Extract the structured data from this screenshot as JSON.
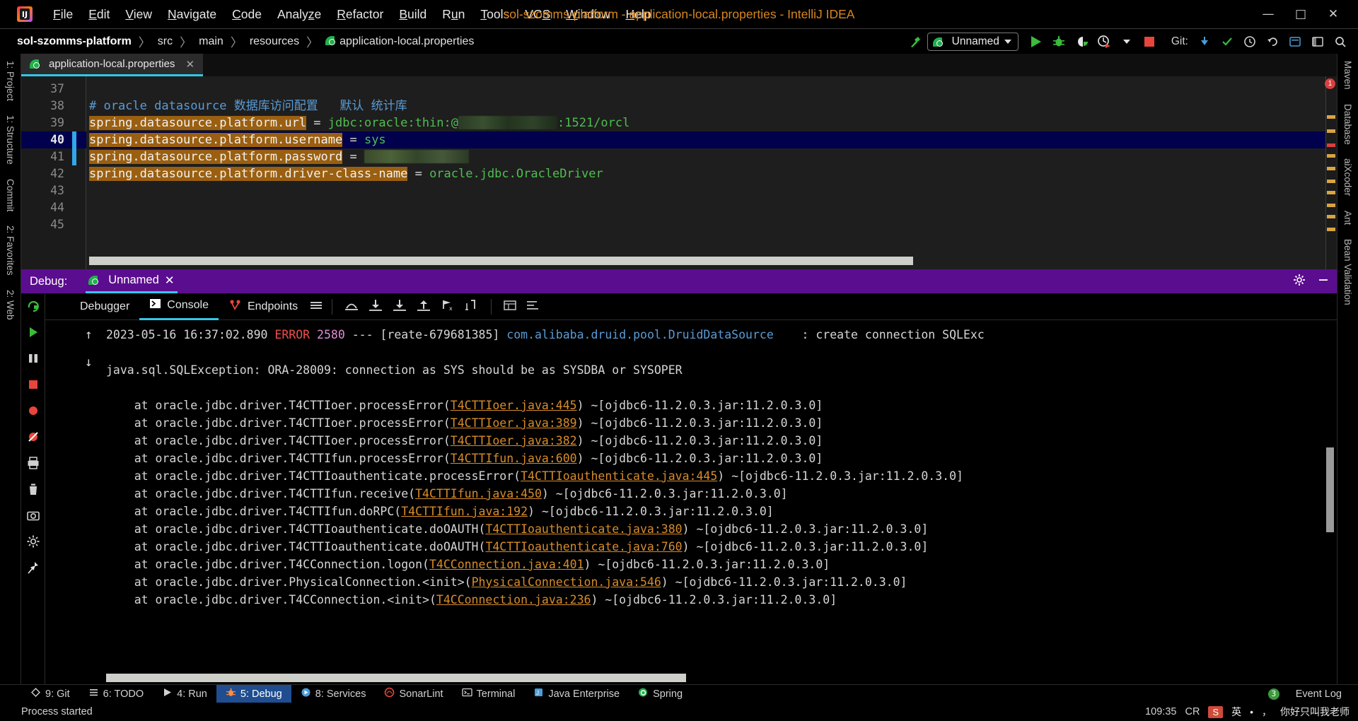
{
  "window": {
    "title": "sol-szomms-platform - application-local.properties - IntelliJ IDEA",
    "minimize": "—",
    "maximize": "□",
    "close": "✕",
    "logo_text": "IJ"
  },
  "menu": [
    {
      "label": "File",
      "mnemonic": "F"
    },
    {
      "label": "Edit",
      "mnemonic": "E"
    },
    {
      "label": "View",
      "mnemonic": "V"
    },
    {
      "label": "Navigate",
      "mnemonic": "N"
    },
    {
      "label": "Code",
      "mnemonic": "C"
    },
    {
      "label": "Analyze",
      "mnemonic": "z"
    },
    {
      "label": "Refactor",
      "mnemonic": "R"
    },
    {
      "label": "Build",
      "mnemonic": "B"
    },
    {
      "label": "Run",
      "mnemonic": "u"
    },
    {
      "label": "Tools",
      "mnemonic": "T"
    },
    {
      "label": "VCS",
      "mnemonic": "S"
    },
    {
      "label": "Window",
      "mnemonic": "W"
    },
    {
      "label": "Help",
      "mnemonic": "H"
    }
  ],
  "breadcrumb": {
    "items": [
      "sol-szomms-platform",
      "src",
      "main",
      "resources",
      "application-local.properties"
    ],
    "separator": "〉"
  },
  "toolbar": {
    "run_config": "Unnamed",
    "git_label": "Git:",
    "build_icon": "build-hammer-icon",
    "run_icon": "run-icon",
    "debug_icon": "debug-icon",
    "coverage_icon": "coverage-icon",
    "profiler_icon": "profiler-icon",
    "stop_icon": "stop-icon",
    "update_icon": "update-project-icon",
    "commit_icon": "commit-icon",
    "history_icon": "history-icon",
    "rollback_icon": "rollback-icon",
    "settings_icon": "settings-icon",
    "layout_icon": "layout-icon",
    "search_icon": "search-icon"
  },
  "left_stripe": [
    {
      "label": "1: Project",
      "name": "tool-project"
    },
    {
      "label": "1: Structure",
      "name": "tool-structure"
    },
    {
      "label": "Commit",
      "name": "tool-commit"
    },
    {
      "label": "2: Favorites",
      "name": "tool-favorites"
    },
    {
      "label": "2: Web",
      "name": "tool-web"
    }
  ],
  "right_stripe": [
    {
      "label": "Maven",
      "name": "tool-maven"
    },
    {
      "label": "Database",
      "name": "tool-database"
    },
    {
      "label": "aiXcoder",
      "name": "tool-aixcoder"
    },
    {
      "label": "Ant",
      "name": "tool-ant"
    },
    {
      "label": "Bean Validation",
      "name": "tool-bean-validation"
    }
  ],
  "editor": {
    "tab_label": "application-local.properties",
    "tab_close": "✕",
    "error_count": "1",
    "lines": [
      {
        "no": "37",
        "segments": []
      },
      {
        "no": "38",
        "segments": [
          {
            "t": "# oracle datasource 数据库访问配置   默认 统计库",
            "c": "k-cmt"
          }
        ]
      },
      {
        "no": "39",
        "segments": [
          {
            "t": "spring.datasource.platform.url",
            "c": "k-key"
          },
          {
            "t": " = ",
            "c": "k-eq"
          },
          {
            "t": "jdbc:oracle:thin:@",
            "c": "k-val"
          },
          {
            "t": "",
            "c": "blur",
            "w": 140
          },
          {
            "t": ":1521/orcl",
            "c": "k-val"
          }
        ]
      },
      {
        "no": "40",
        "selected": true,
        "segments": [
          {
            "t": "spring.datasource.platform.username",
            "c": "k-key"
          },
          {
            "t": " = ",
            "c": "k-eq"
          },
          {
            "t": "sys",
            "c": "k-val"
          }
        ]
      },
      {
        "no": "41",
        "segments": [
          {
            "t": "spring.datasource.platform.password",
            "c": "k-key"
          },
          {
            "t": " = ",
            "c": "k-eq"
          },
          {
            "t": "",
            "c": "blurpw",
            "w": 148
          }
        ]
      },
      {
        "no": "42",
        "segments": [
          {
            "t": "spring.datasource.platform.driver-class-name",
            "c": "k-key"
          },
          {
            "t": " = ",
            "c": "k-eq"
          },
          {
            "t": "oracle.jdbc.OracleDriver",
            "c": "k-val"
          }
        ]
      },
      {
        "no": "43",
        "segments": []
      },
      {
        "no": "44",
        "segments": []
      },
      {
        "no": "45",
        "segments": []
      }
    ]
  },
  "debug": {
    "panel_label": "Debug:",
    "session_tab": "Unnamed",
    "session_close": "✕",
    "settings_icon": "settings-gear-icon",
    "hide_icon": "hide-panel-icon",
    "tabs": [
      {
        "label": "Debugger",
        "icon": "debugger-icon",
        "active": false
      },
      {
        "label": "Console",
        "icon": "console-icon",
        "active": true
      },
      {
        "label": "Endpoints",
        "icon": "endpoints-icon",
        "active": false
      }
    ],
    "toolbar_icons": [
      "layout-menu-icon",
      "step-over-icon",
      "step-into-icon",
      "force-step-into-icon",
      "step-out-icon",
      "run-to-cursor-icon",
      "evaluate-icon",
      "frames-icon",
      "soft-wrap-icon"
    ],
    "side_icons": [
      "rerun-icon",
      "resume-icon",
      "pause-icon",
      "stop-icon",
      "view-breakpoints-icon",
      "mute-breakpoints-icon",
      "print-icon",
      "delete-icon",
      "camera-icon",
      "settings-icon",
      "pin-icon"
    ],
    "stack_arrows": [
      "↑",
      "↓"
    ],
    "console_lines": [
      {
        "segments": [
          {
            "t": "2023-05-16 16:37:02.890 ",
            "c": "plain"
          },
          {
            "t": "ERROR",
            "c": "c-err"
          },
          {
            "t": " ",
            "c": "plain"
          },
          {
            "t": "2580",
            "c": "c-pid"
          },
          {
            "t": " --- [reate-679681385] ",
            "c": "plain"
          },
          {
            "t": "com.alibaba.druid.pool.DruidDataSource",
            "c": "c-cls"
          },
          {
            "t": "    : create connection SQLExc",
            "c": "plain"
          }
        ]
      },
      {
        "segments": []
      },
      {
        "segments": [
          {
            "t": "java.sql.SQLException: ORA-28009: connection as SYS should be as SYSDBA or SYSOPER",
            "c": "plain"
          }
        ]
      },
      {
        "segments": []
      },
      {
        "segments": [
          {
            "t": "    at oracle.jdbc.driver.T4CTTIoer.processError(",
            "c": "plain"
          },
          {
            "t": "T4CTTIoer.java:445",
            "c": "c-link"
          },
          {
            "t": ") ~[ojdbc6-11.2.0.3.jar:11.2.0.3.0]",
            "c": "plain"
          }
        ]
      },
      {
        "segments": [
          {
            "t": "    at oracle.jdbc.driver.T4CTTIoer.processError(",
            "c": "plain"
          },
          {
            "t": "T4CTTIoer.java:389",
            "c": "c-link"
          },
          {
            "t": ") ~[ojdbc6-11.2.0.3.jar:11.2.0.3.0]",
            "c": "plain"
          }
        ]
      },
      {
        "segments": [
          {
            "t": "    at oracle.jdbc.driver.T4CTTIoer.processError(",
            "c": "plain"
          },
          {
            "t": "T4CTTIoer.java:382",
            "c": "c-link"
          },
          {
            "t": ") ~[ojdbc6-11.2.0.3.jar:11.2.0.3.0]",
            "c": "plain"
          }
        ]
      },
      {
        "segments": [
          {
            "t": "    at oracle.jdbc.driver.T4CTTIfun.processError(",
            "c": "plain"
          },
          {
            "t": "T4CTTIfun.java:600",
            "c": "c-link"
          },
          {
            "t": ") ~[ojdbc6-11.2.0.3.jar:11.2.0.3.0]",
            "c": "plain"
          }
        ]
      },
      {
        "segments": [
          {
            "t": "    at oracle.jdbc.driver.T4CTTIoauthenticate.processError(",
            "c": "plain"
          },
          {
            "t": "T4CTTIoauthenticate.java:445",
            "c": "c-link"
          },
          {
            "t": ") ~[ojdbc6-11.2.0.3.jar:11.2.0.3.0]",
            "c": "plain"
          }
        ]
      },
      {
        "segments": [
          {
            "t": "    at oracle.jdbc.driver.T4CTTIfun.receive(",
            "c": "plain"
          },
          {
            "t": "T4CTTIfun.java:450",
            "c": "c-link"
          },
          {
            "t": ") ~[ojdbc6-11.2.0.3.jar:11.2.0.3.0]",
            "c": "plain"
          }
        ]
      },
      {
        "segments": [
          {
            "t": "    at oracle.jdbc.driver.T4CTTIfun.doRPC(",
            "c": "plain"
          },
          {
            "t": "T4CTTIfun.java:192",
            "c": "c-link"
          },
          {
            "t": ") ~[ojdbc6-11.2.0.3.jar:11.2.0.3.0]",
            "c": "plain"
          }
        ]
      },
      {
        "segments": [
          {
            "t": "    at oracle.jdbc.driver.T4CTTIoauthenticate.doOAUTH(",
            "c": "plain"
          },
          {
            "t": "T4CTTIoauthenticate.java:380",
            "c": "c-link"
          },
          {
            "t": ") ~[ojdbc6-11.2.0.3.jar:11.2.0.3.0]",
            "c": "plain"
          }
        ]
      },
      {
        "segments": [
          {
            "t": "    at oracle.jdbc.driver.T4CTTIoauthenticate.doOAUTH(",
            "c": "plain"
          },
          {
            "t": "T4CTTIoauthenticate.java:760",
            "c": "c-link"
          },
          {
            "t": ") ~[ojdbc6-11.2.0.3.jar:11.2.0.3.0]",
            "c": "plain"
          }
        ]
      },
      {
        "segments": [
          {
            "t": "    at oracle.jdbc.driver.T4CConnection.logon(",
            "c": "plain"
          },
          {
            "t": "T4CConnection.java:401",
            "c": "c-link"
          },
          {
            "t": ") ~[ojdbc6-11.2.0.3.jar:11.2.0.3.0]",
            "c": "plain"
          }
        ]
      },
      {
        "segments": [
          {
            "t": "    at oracle.jdbc.driver.PhysicalConnection.<init>(",
            "c": "plain"
          },
          {
            "t": "PhysicalConnection.java:546",
            "c": "c-link"
          },
          {
            "t": ") ~[ojdbc6-11.2.0.3.jar:11.2.0.3.0]",
            "c": "plain"
          }
        ]
      },
      {
        "segments": [
          {
            "t": "    at oracle.jdbc.driver.T4CConnection.<init>(",
            "c": "plain"
          },
          {
            "t": "T4CConnection.java:236",
            "c": "c-link"
          },
          {
            "t": ") ~[ojdbc6-11.2.0.3.jar:11.2.0.3.0]",
            "c": "plain"
          }
        ]
      }
    ]
  },
  "statusbar": {
    "items": [
      {
        "label": "9: Git",
        "icon": "git-icon",
        "active": false
      },
      {
        "label": "6: TODO",
        "icon": "todo-icon",
        "active": false
      },
      {
        "label": "4: Run",
        "icon": "run-icon",
        "active": false
      },
      {
        "label": "5: Debug",
        "icon": "debug-icon",
        "active": true
      },
      {
        "label": "8: Services",
        "icon": "services-icon",
        "active": false
      },
      {
        "label": "SonarLint",
        "icon": "sonarlint-icon",
        "active": false
      },
      {
        "label": "Terminal",
        "icon": "terminal-icon",
        "active": false
      },
      {
        "label": "Java Enterprise",
        "icon": "java-enterprise-icon",
        "active": false
      },
      {
        "label": "Spring",
        "icon": "spring-icon",
        "active": false
      }
    ],
    "event_log": "Event Log",
    "event_count": "3"
  },
  "bottombar": {
    "process_status": "Process started",
    "caret_position": "109:35",
    "line_separator": "CR",
    "ime_badge": "S",
    "ime_mode": "英",
    "ime_hint": "你好只叫我老师"
  }
}
